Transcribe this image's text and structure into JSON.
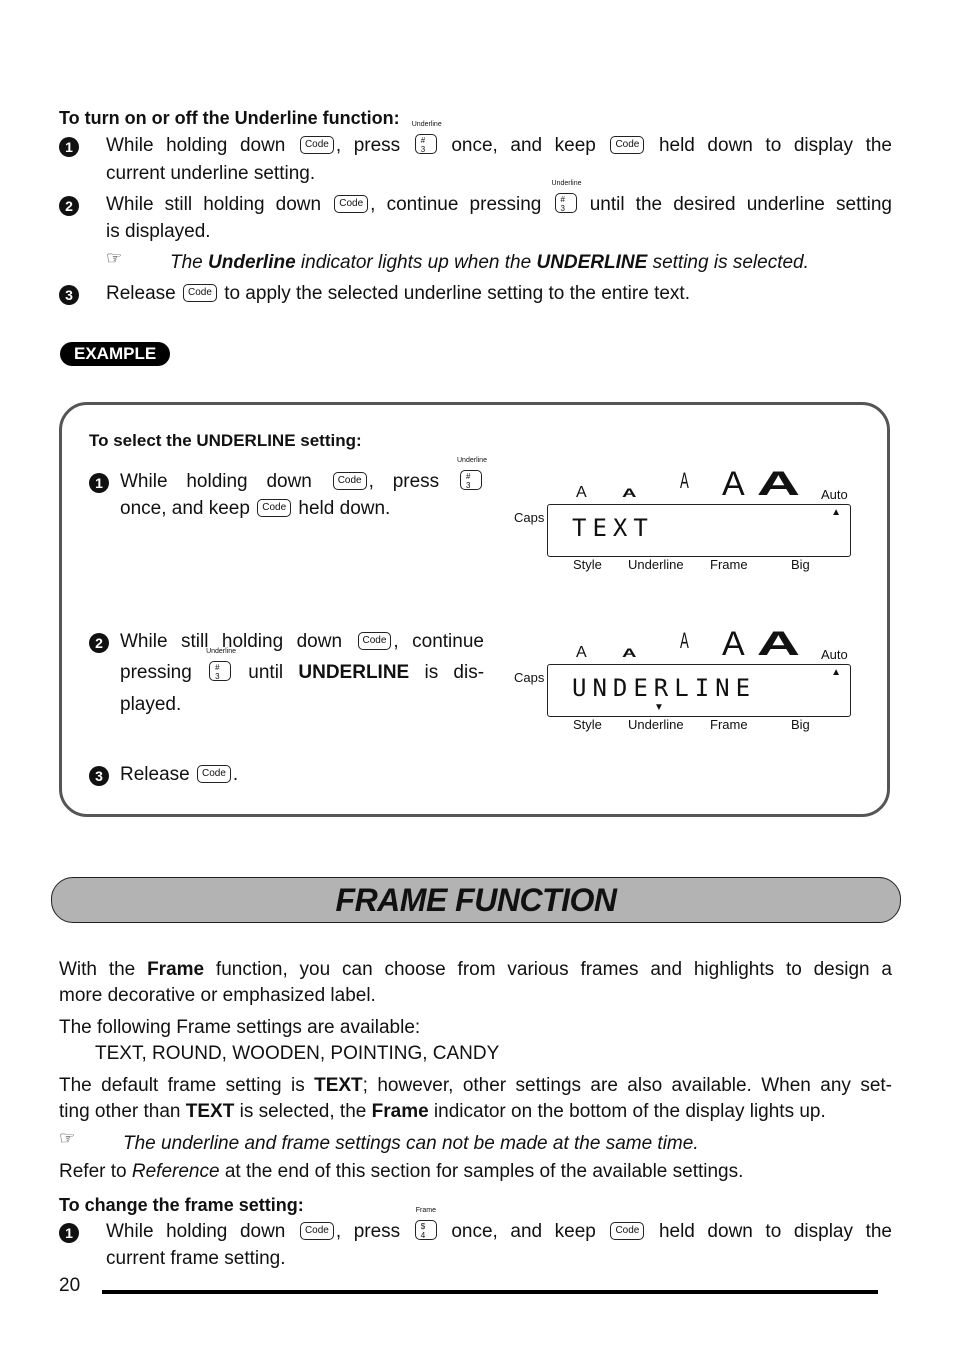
{
  "underline_section": {
    "heading": "To turn on or off the Underline function:",
    "steps": [
      {
        "num": "1",
        "parts": [
          "While holding down",
          ", press",
          "once, and keep",
          "held down to display the"
        ],
        "line2": "current underline setting."
      },
      {
        "num": "2",
        "parts": [
          "While still holding down",
          ", continue pressing",
          "until the desired underline setting"
        ],
        "line2": "is displayed."
      },
      {
        "num": "3",
        "parts": [
          "Release",
          "to apply the selected underline setting to the entire text."
        ]
      }
    ],
    "note": {
      "icon": "pointing-hand-icon",
      "pre": "The ",
      "bold1": "Underline",
      "mid": " indicator lights up when the ",
      "bold2": "UNDERLINE",
      "post": " setting is selected."
    }
  },
  "keys": {
    "code": "Code",
    "underline_key_caption": "Underline",
    "underline_key_symbol": "#",
    "underline_key_number": "3",
    "frame_key_caption": "Frame",
    "frame_key_symbol": "$",
    "frame_key_number": "4"
  },
  "example": {
    "badge": "EXAMPLE",
    "heading": "To select the UNDERLINE setting:",
    "step1": {
      "num": "1",
      "a": "While holding down",
      "b": ", press",
      "c": "once, and keep",
      "d": "held down."
    },
    "step2": {
      "num": "2",
      "a": "While still holding down",
      "b": ", continue",
      "c": "pressing",
      "d": "until",
      "bold": "UNDERLINE",
      "e": "is dis-",
      "f": "played."
    },
    "step3": {
      "num": "3",
      "a": "Release",
      "b": "."
    },
    "displays": [
      {
        "size_glyphs": [
          "A",
          "A",
          "A",
          "A",
          "A"
        ],
        "auto": "Auto",
        "caps": "Caps",
        "text": "TEXT",
        "bottom_labels": [
          "Style",
          "Underline",
          "Frame",
          "Big"
        ],
        "underline_indicator": false
      },
      {
        "size_glyphs": [
          "A",
          "A",
          "A",
          "A",
          "A"
        ],
        "auto": "Auto",
        "caps": "Caps",
        "text": "UNDERLINE",
        "bottom_labels": [
          "Style",
          "Underline",
          "Frame",
          "Big"
        ],
        "underline_indicator": true
      }
    ]
  },
  "frame_section": {
    "title": "FRAME FUNCTION",
    "p1": {
      "a": "With the ",
      "b": "Frame",
      "c": " function, you can choose from various frames and highlights to design a",
      "d": "more decorative or emphasized label."
    },
    "p2": "The following Frame settings are available:",
    "settings": "TEXT, ROUND, WOODEN, POINTING, CANDY",
    "p3": {
      "a": "The default frame setting is ",
      "b": "TEXT",
      "c": "; however, other settings are also available. When any set-",
      "d": "ting other than ",
      "e": "TEXT",
      "f": " is selected, the ",
      "g": "Frame",
      "h": " indicator on the bottom of the display lights up."
    },
    "note": "The underline and frame settings can not be made at the same time.",
    "p4": {
      "a": "Refer to ",
      "b": "Reference",
      "c": " at the end of this section for samples of the available settings."
    },
    "heading": "To change the frame setting:",
    "step1": {
      "num": "1",
      "a": "While holding down",
      "b": ", press",
      "c": "once, and keep",
      "d": "held down to display the",
      "line2": "current frame setting."
    }
  },
  "footer": {
    "page_number": "20"
  }
}
